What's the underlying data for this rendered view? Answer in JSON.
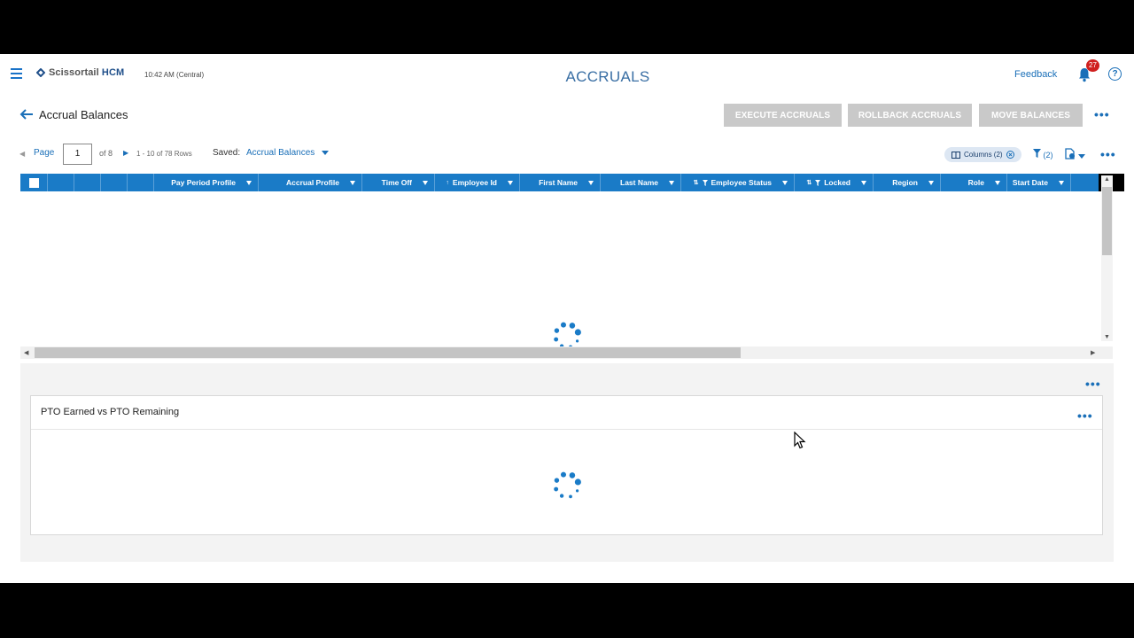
{
  "app": {
    "brand_prefix": "Scissortail ",
    "brand_suffix": "HCM",
    "clock": "10:42 AM (Central)",
    "page_title": "ACCRUALS",
    "feedback_label": "Feedback",
    "notification_count": "27",
    "help_label": "?",
    "accent_color": "#1a7bc7"
  },
  "toolbar": {
    "heading": "Accrual Balances",
    "execute_label": "EXECUTE ACCRUALS",
    "rollback_label": "ROLLBACK ACCRUALS",
    "move_label": "MOVE BALANCES",
    "more_label": "•••"
  },
  "pager": {
    "page_label": "Page",
    "current_page": "1",
    "of_label": "of 8",
    "rows_label": "1 - 10 of 78 Rows",
    "saved_label": "Saved:",
    "saved_value": "Accrual Balances",
    "columns_label": "Columns (2)",
    "filter_label": "(2)",
    "more_label": "•••"
  },
  "grid": {
    "columns": [
      {
        "label": "Pay Period Profile",
        "sort": "",
        "filtered": false
      },
      {
        "label": "Accrual Profile",
        "sort": "",
        "filtered": false
      },
      {
        "label": "Time Off",
        "sort": "",
        "filtered": false
      },
      {
        "label": "Employee Id",
        "sort": "↑",
        "filtered": false
      },
      {
        "label": "First Name",
        "sort": "",
        "filtered": false
      },
      {
        "label": "Last Name",
        "sort": "",
        "filtered": false
      },
      {
        "label": "Employee Status",
        "sort": "⇅",
        "filtered": true
      },
      {
        "label": "Locked",
        "sort": "⇅",
        "filtered": true
      },
      {
        "label": "Region",
        "sort": "",
        "filtered": false
      },
      {
        "label": "Role",
        "sort": "",
        "filtered": false
      },
      {
        "label": "Start Date",
        "sort": "",
        "filtered": false
      }
    ],
    "loading": true
  },
  "chart_panel": {
    "more_label": "•••",
    "card_title": "PTO Earned vs PTO Remaining",
    "card_more_label": "•••",
    "loading": true
  }
}
